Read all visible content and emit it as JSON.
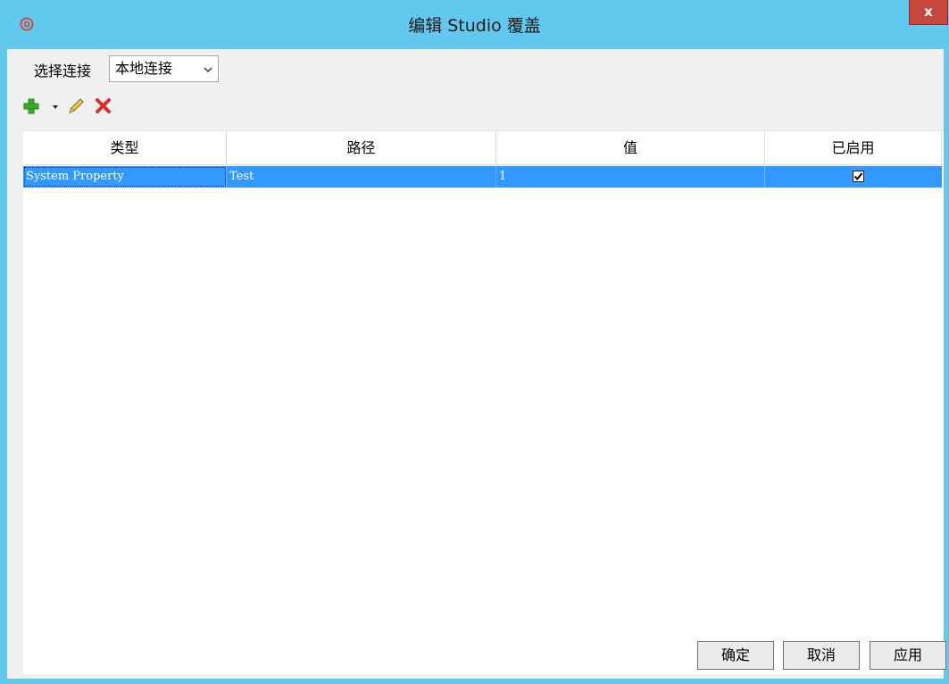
{
  "window": {
    "title": "编辑 Studio 覆盖",
    "close_label": "x"
  },
  "connection": {
    "label": "选择连接",
    "selected": "本地连接"
  },
  "toolbar": {
    "icons": [
      "add-icon",
      "dropdown-arrow-icon",
      "edit-pencil-icon",
      "delete-icon"
    ]
  },
  "table": {
    "columns": [
      "类型",
      "路径",
      "值",
      "已启用"
    ],
    "rows": [
      {
        "type": "System Property",
        "path": "Test",
        "value": "1",
        "enabled": true
      }
    ]
  },
  "buttons": {
    "ok": "确定",
    "cancel": "取消",
    "apply": "应用"
  },
  "colors": {
    "titlebar": "#63c8ee",
    "selection": "#3399ff",
    "close": "#c7463d"
  }
}
